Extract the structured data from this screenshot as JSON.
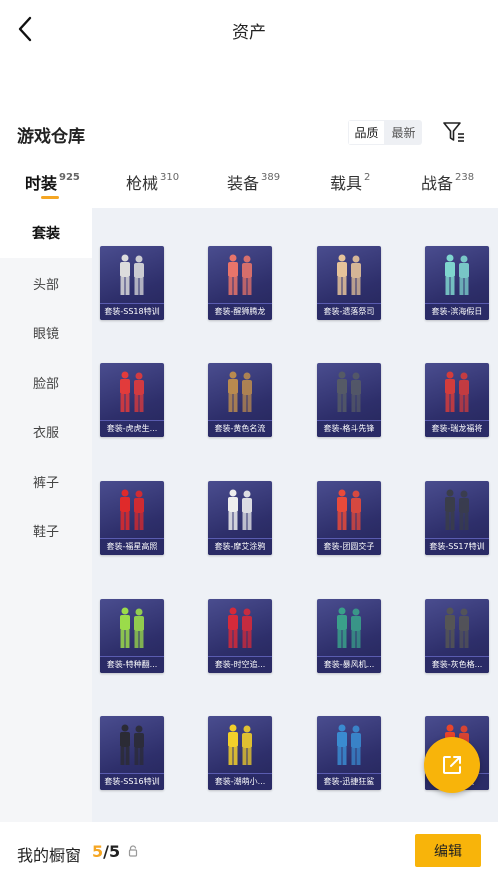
{
  "header": {
    "title": "资产"
  },
  "section": {
    "title": "游戏仓库"
  },
  "sort": {
    "quality_label": "品质",
    "newest_label": "最新"
  },
  "tabs": [
    {
      "label": "时装",
      "count": "925"
    },
    {
      "label": "枪械",
      "count": "310"
    },
    {
      "label": "装备",
      "count": "389"
    },
    {
      "label": "载具",
      "count": "2"
    },
    {
      "label": "战备",
      "count": "238"
    }
  ],
  "sidebar": {
    "items": [
      {
        "label": "套装"
      },
      {
        "label": "头部"
      },
      {
        "label": "眼镜"
      },
      {
        "label": "脸部"
      },
      {
        "label": "衣服"
      },
      {
        "label": "裤子"
      },
      {
        "label": "鞋子"
      }
    ]
  },
  "grid": {
    "items": [
      {
        "caption": "套装-SS18特训",
        "accent": "#dcdcdc"
      },
      {
        "caption": "套装-醒狮腾龙",
        "accent": "#e8746a"
      },
      {
        "caption": "套装-遗落祭司",
        "accent": "#e6c39a"
      },
      {
        "caption": "套装-滨海假日",
        "accent": "#7fd6cf"
      },
      {
        "caption": "套装-虎虎生...",
        "accent": "#e23b3b"
      },
      {
        "caption": "套装-黄色名流",
        "accent": "#b98a4f"
      },
      {
        "caption": "套装-格斗先锋",
        "accent": "#555a66"
      },
      {
        "caption": "套装-瑞龙福将",
        "accent": "#d23c3c"
      },
      {
        "caption": "套装-福星高照",
        "accent": "#e02a2a"
      },
      {
        "caption": "套装-摩艾涂鸦",
        "accent": "#eeeeee"
      },
      {
        "caption": "套装-团圆交子",
        "accent": "#e84a3a"
      },
      {
        "caption": "套装-SS17特训",
        "accent": "#3a3d4a"
      },
      {
        "caption": "套装-特种翻...",
        "accent": "#9bdc4a"
      },
      {
        "caption": "套装-时空追...",
        "accent": "#d52a3a"
      },
      {
        "caption": "套装-暴风机...",
        "accent": "#3aa08a"
      },
      {
        "caption": "套装-灰色格...",
        "accent": "#555555"
      },
      {
        "caption": "套装-SS16特训",
        "accent": "#2b2b35"
      },
      {
        "caption": "套装-潮萌小...",
        "accent": "#f2cf2a"
      },
      {
        "caption": "套装-迅捷狂鲨",
        "accent": "#3a8bd0"
      },
      {
        "caption": "套装-...螯",
        "accent": "#e8452a"
      }
    ]
  },
  "wardrobe": {
    "label": "我的橱窗",
    "used": "5",
    "separator": "/",
    "total": "5"
  },
  "edit": {
    "label": "编辑"
  },
  "colors": {
    "accent": "#f5a623",
    "button": "#f8b40a",
    "card": "#2e2f6b"
  }
}
